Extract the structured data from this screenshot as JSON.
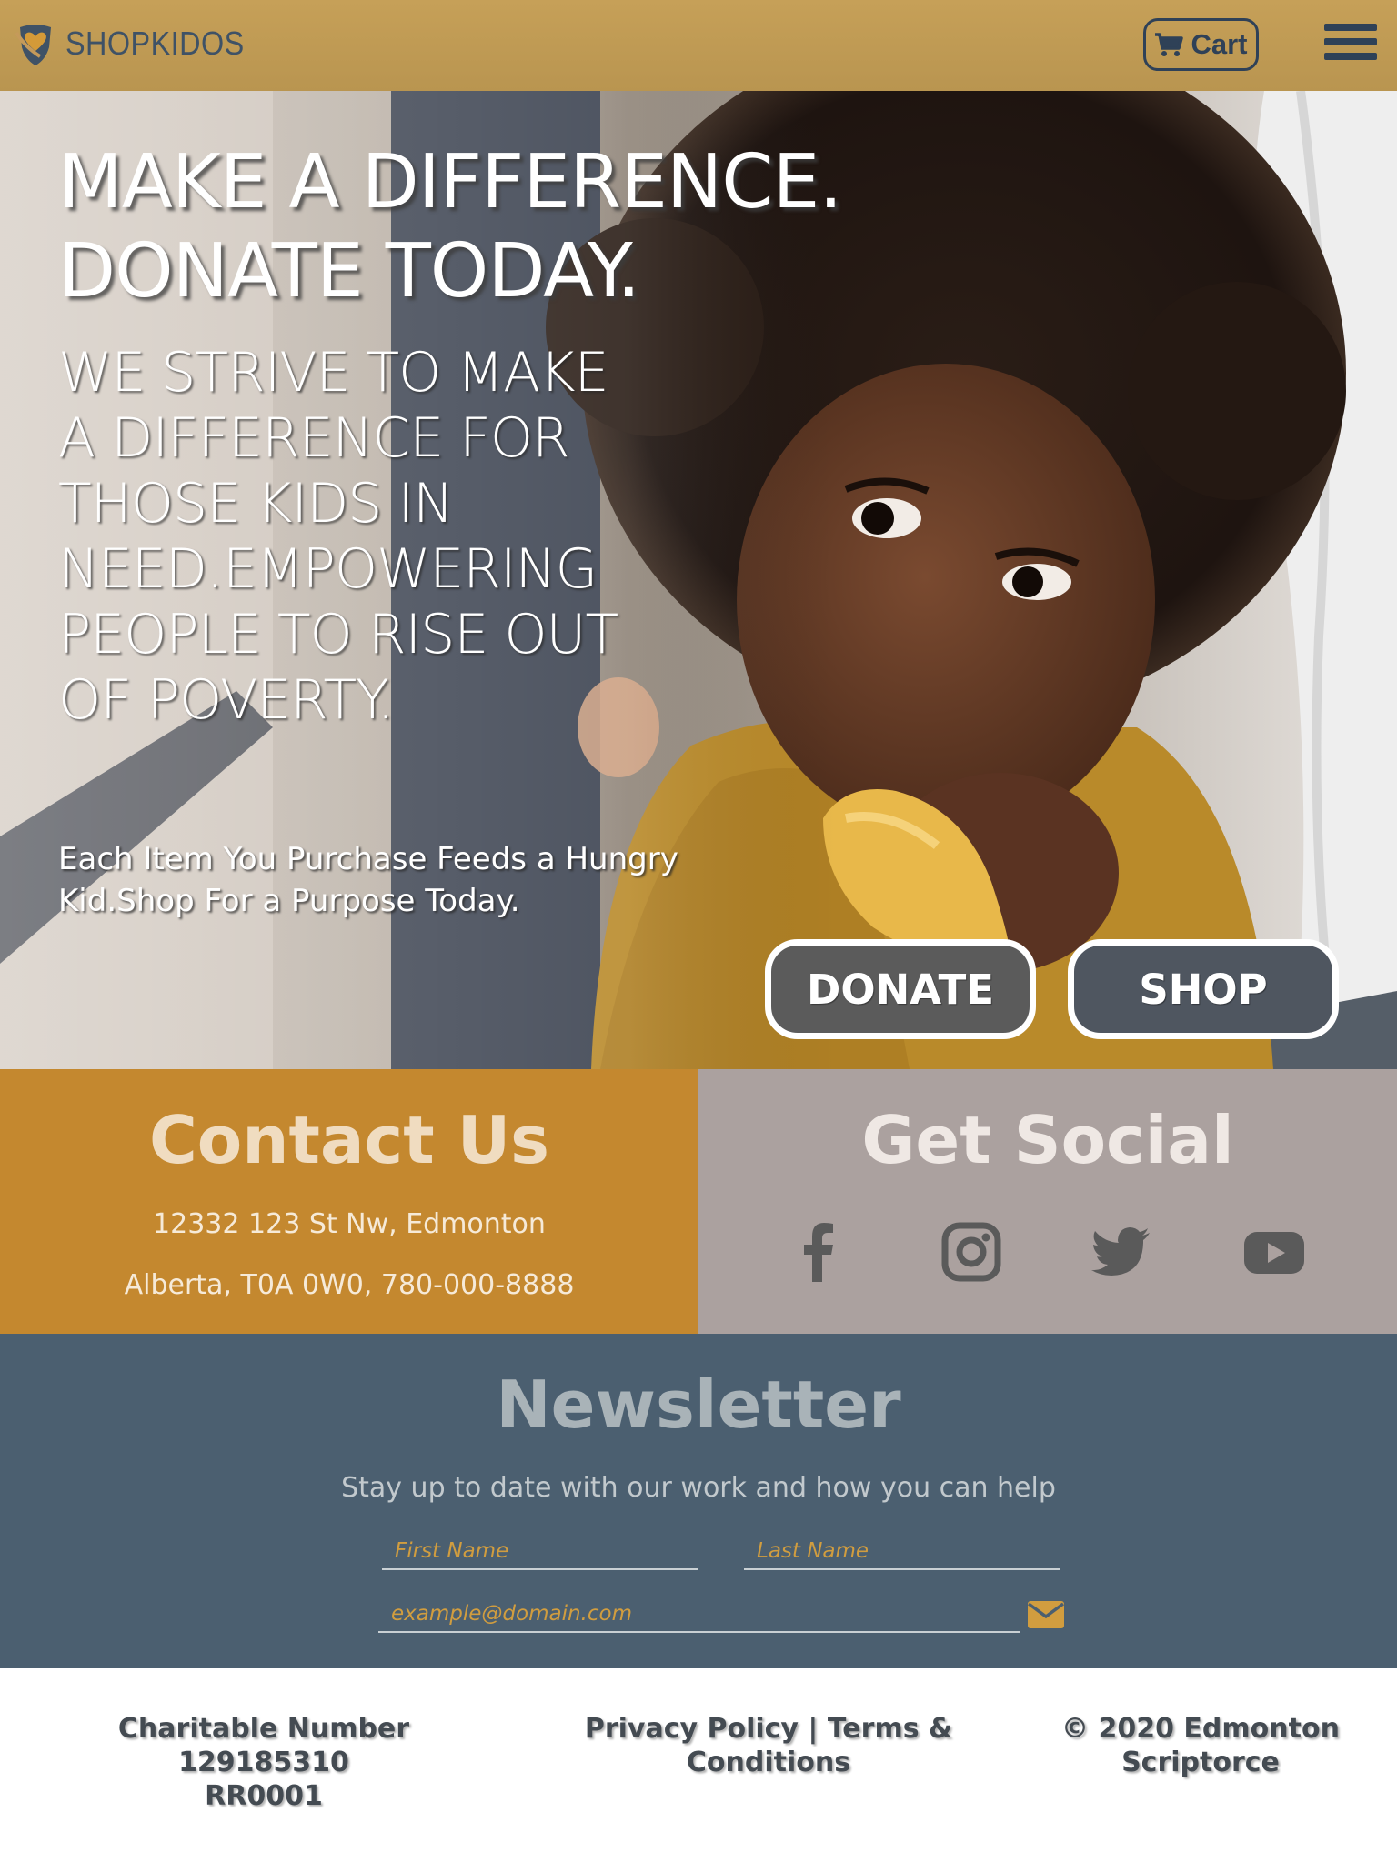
{
  "header": {
    "brand": "SHOPKIDOS",
    "cart_label": "Cart",
    "logo_icon": "shield-heart-logo",
    "cart_icon": "shopping-cart-icon",
    "menu_icon": "hamburger-menu-icon"
  },
  "hero": {
    "title_line1": "MAKE A DIFFERENCE.",
    "title_line2": "DONATE TODAY.",
    "mission": "WE STRIVE TO MAKE A DIFFERENCE FOR THOSE KIDS IN NEED.EMPOWERING PEOPLE TO RISE OUT OF POVERTY.",
    "tagline_line1": "Each Item You Purchase Feeds a Hungry",
    "tagline_line2": "Kid.Shop For a Purpose Today.",
    "donate_label": "DONATE",
    "shop_label": "SHOP"
  },
  "contact": {
    "title": "Contact Us",
    "address_line1": "12332 123 St Nw, Edmonton",
    "address_line2": "Alberta, T0A 0W0, 780-000-8888"
  },
  "social": {
    "title": "Get Social",
    "icons": [
      "facebook-icon",
      "instagram-icon",
      "twitter-icon",
      "youtube-icon"
    ]
  },
  "newsletter": {
    "title": "Newsletter",
    "subtitle": "Stay up to date with our work and how you can help",
    "first_name_placeholder": "First Name",
    "last_name_placeholder": "Last Name",
    "email_placeholder": "example@domain.com"
  },
  "footer": {
    "charity_line1": "Charitable Number 129185310",
    "charity_line2": "RR0001",
    "legal_line1": "Privacy Policy | Terms &",
    "legal_line2": "Conditions",
    "copyright_line1": "© 2020 Edmonton",
    "copyright_line2": "Scriptorce"
  },
  "colors": {
    "header_bg": "#c09a52",
    "brand_text": "#3f5266",
    "contact_bg": "#c4882f",
    "social_bg": "#aba19f",
    "newsletter_bg": "#4b5f70",
    "accent": "#d19d3f"
  }
}
